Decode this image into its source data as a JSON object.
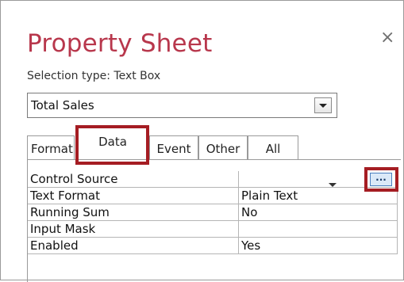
{
  "panel": {
    "title": "Property Sheet",
    "close_glyph": "×",
    "selection_label": "Selection type:  Text Box"
  },
  "object_select": {
    "value": "Total Sales"
  },
  "tabs": [
    {
      "label": "Format",
      "active": false
    },
    {
      "label": "Data",
      "active": true
    },
    {
      "label": "Event",
      "active": false
    },
    {
      "label": "Other",
      "active": false
    },
    {
      "label": "All",
      "active": false
    }
  ],
  "properties": [
    {
      "name": "Control Source",
      "value": ""
    },
    {
      "name": "Text Format",
      "value": "Plain Text"
    },
    {
      "name": "Running Sum",
      "value": "No"
    },
    {
      "name": "Input Mask",
      "value": ""
    },
    {
      "name": "Enabled",
      "value": "Yes"
    }
  ],
  "build_button": {
    "label": "..."
  },
  "colors": {
    "title": "#b8374c",
    "highlight": "#a51d23"
  }
}
